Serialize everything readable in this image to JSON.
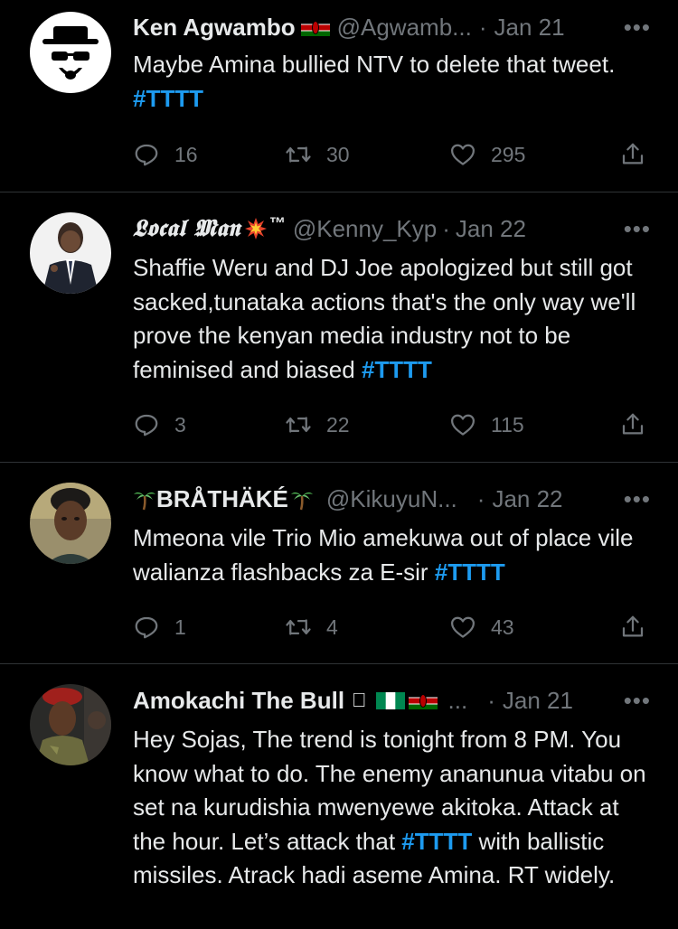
{
  "tweets": [
    {
      "display_name": "Ken Agwambo",
      "handle": "@Agwamb...",
      "separator": "·",
      "date": "Jan 21",
      "more": "•••",
      "text_before": "Maybe Amina bullied NTV to delete that tweet. ",
      "hashtag": "#TTTT",
      "text_after": "",
      "reply_count": "16",
      "retweet_count": "30",
      "like_count": "295"
    },
    {
      "display_name": "𝕷𝖔𝖈𝖆𝖑 𝕸𝖆𝖓",
      "name_suffix": "™",
      "handle": "@Kenny_Kyp",
      "separator": "·",
      "date": "Jan 22",
      "more": "•••",
      "text_before": "Shaffie Weru and DJ Joe apologized but still got sacked,tunataka actions that's the only way we'll prove the kenyan media industry not to be feminised and biased ",
      "hashtag": "#TTTT",
      "text_after": "",
      "reply_count": "3",
      "retweet_count": "22",
      "like_count": "115"
    },
    {
      "display_name": "BRÅTHÄKÉ",
      "handle": "@KikuyuN...",
      "separator": "·",
      "date": "Jan 22",
      "more": "•••",
      "text_before": "Mmeona vile Trio Mio amekuwa out of place vile walianza flashbacks za E-sir ",
      "hashtag": "#TTTT",
      "text_after": "",
      "reply_count": "1",
      "retweet_count": "4",
      "like_count": "43"
    },
    {
      "display_name": "Amokachi The Bull",
      "name_extra": "",
      "ellipsis": "...",
      "separator": "·",
      "date": "Jan 21",
      "more": "•••",
      "text_before": "Hey Sojas, The trend is tonight from 8 PM. You know what to do. The enemy ananunua vitabu on set na kurudishia mwenyewe akitoka. Attack at the hour. Let’s attack that ",
      "hashtag": "#TTTT",
      "text_after": " with ballistic missiles. Atrack hadi aseme Amina. RT widely."
    }
  ],
  "icons": {
    "reply": "reply-icon",
    "retweet": "retweet-icon",
    "like": "heart-icon",
    "share": "share-icon",
    "more": "more-icon"
  },
  "colors": {
    "background": "#000000",
    "text": "#e7e9ea",
    "secondary": "#71767b",
    "accent": "#1d9bf0",
    "divider": "#2f3336"
  }
}
